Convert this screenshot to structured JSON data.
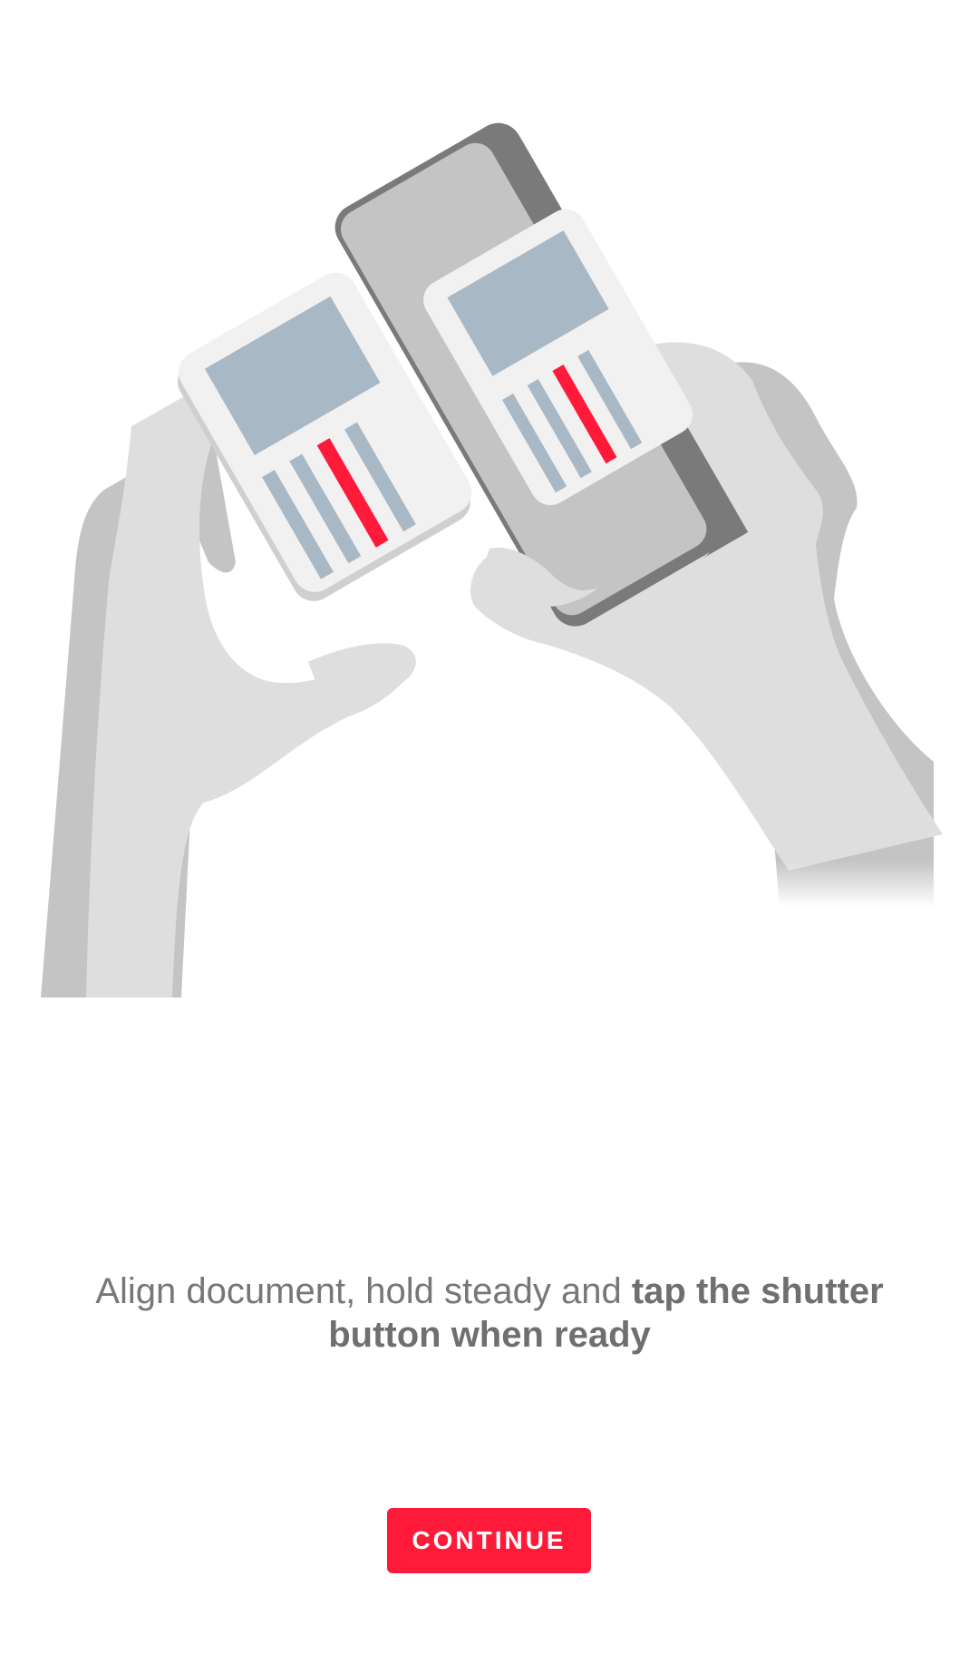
{
  "instruction": {
    "normal": "Align document, hold steady and ",
    "bold": "tap the shutter button when ready"
  },
  "continue_button": {
    "label": "CONTINUE"
  },
  "colors": {
    "accent": "#ff1a3a",
    "text": "#777777",
    "skin": "#dcdcdc",
    "phone": "#7a7a7a",
    "document": "#f1f1f1",
    "document_block": "#a8b8c4"
  }
}
